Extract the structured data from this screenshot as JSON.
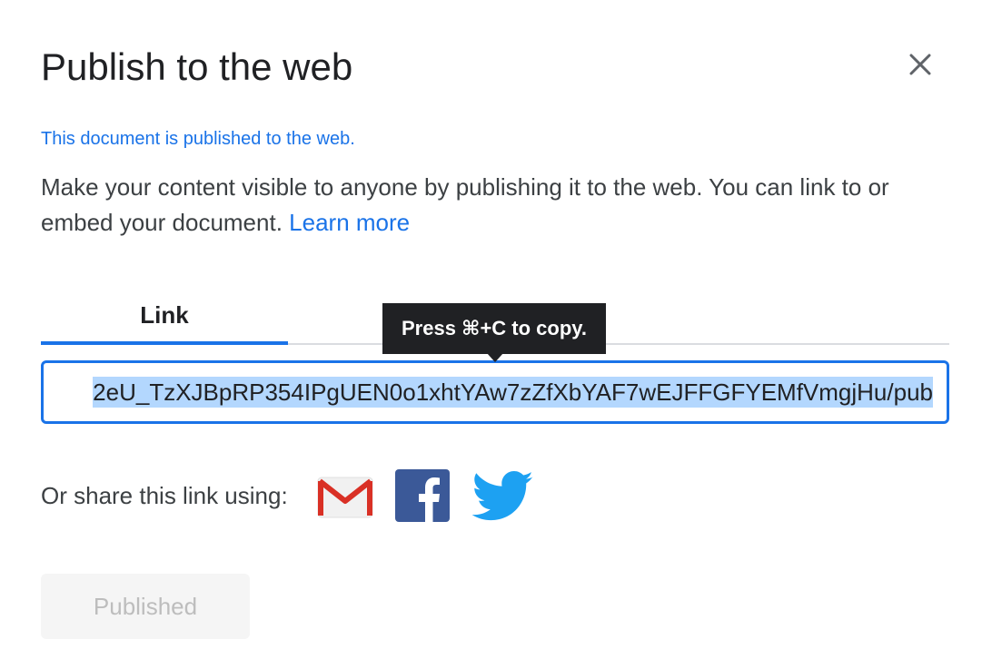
{
  "dialog": {
    "title": "Publish to the web",
    "close_icon": "close-icon",
    "status_text": "This document is published to the web.",
    "description": "Make your content visible to anyone by publishing it to the web. You can link to or embed your document.",
    "learn_more": "Learn more"
  },
  "tabs": {
    "link_label": "Link"
  },
  "tooltip": {
    "text": "Press ⌘+C to copy."
  },
  "link_field": {
    "value": "2eU_TzXJBpRP354IPgUEN0o1xhtYAw7zZfXbYAF7wEJFFGFYEMfVmgjHu/pub"
  },
  "share": {
    "label": "Or share this link using:",
    "icons": [
      "gmail-icon",
      "facebook-icon",
      "twitter-icon"
    ]
  },
  "button": {
    "published_label": "Published"
  },
  "colors": {
    "accent": "#1a73e8",
    "tooltip_bg": "#202124",
    "selection": "#b3d7fe",
    "facebook": "#3b5998",
    "twitter": "#1da1f2",
    "gmail_red": "#d93025"
  }
}
